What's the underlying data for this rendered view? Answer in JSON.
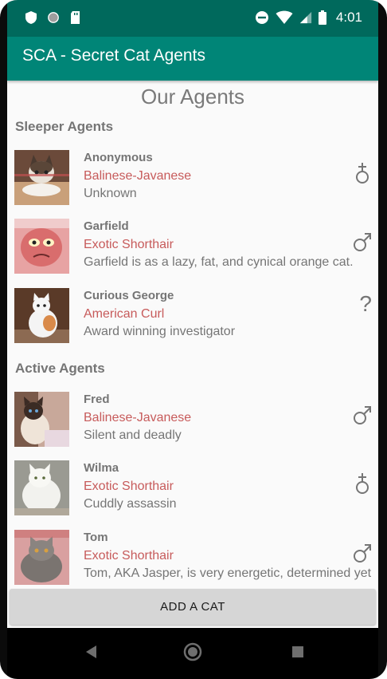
{
  "status_bar": {
    "time": "4:01"
  },
  "app_bar": {
    "title": "SCA - Secret Cat Agents"
  },
  "page": {
    "title": "Our Agents"
  },
  "sections": [
    {
      "header": "Sleeper Agents",
      "agents": [
        {
          "name": "Anonymous",
          "breed": "Balinese-Javanese",
          "description": "Unknown",
          "gender_icon": "neutered-icon"
        },
        {
          "name": "Garfield",
          "breed": "Exotic Shorthair",
          "description": "Garfield is as a lazy, fat, and cynical orange cat.",
          "gender_icon": "male-icon"
        },
        {
          "name": "Curious George",
          "breed": "American Curl",
          "description": "Award winning investigator",
          "gender_icon": "unknown-icon",
          "gender_text": "?"
        }
      ]
    },
    {
      "header": "Active Agents",
      "agents": [
        {
          "name": "Fred",
          "breed": "Balinese-Javanese",
          "description": "Silent and deadly",
          "gender_icon": "male-icon"
        },
        {
          "name": "Wilma",
          "breed": "Exotic Shorthair",
          "description": "Cuddly assassin",
          "gender_icon": "neutered-icon"
        },
        {
          "name": "Tom",
          "breed": "Exotic Shorthair",
          "description": "Tom, AKA Jasper, is very energetic, determined yet",
          "gender_icon": "male-icon"
        }
      ]
    }
  ],
  "add_button": {
    "label": "ADD A CAT"
  },
  "colors": {
    "status_bar": "#00695c",
    "app_bar": "#008577",
    "breed_text": "#c75b5b",
    "secondary_text": "#757575"
  }
}
